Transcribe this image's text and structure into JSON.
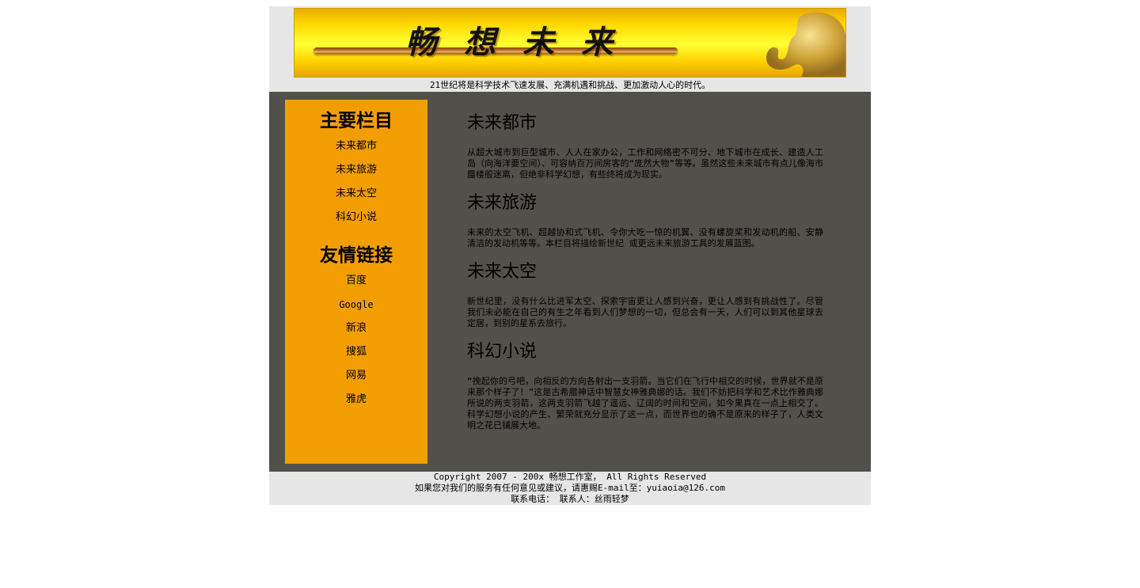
{
  "header": {
    "banner_title": "畅想未来",
    "tagline": "21世纪将是科学技术飞速发展、充满机遇和挑战、更加激动人心的时代。"
  },
  "sidebar": {
    "main_title": "主要栏目",
    "main_items": [
      "未来都市",
      "未来旅游",
      "未来太空",
      "科幻小说"
    ],
    "links_title": "友情链接",
    "link_items": [
      "百度",
      "Google",
      "新浪",
      "搜狐",
      "网易",
      "雅虎"
    ]
  },
  "content": {
    "sections": [
      {
        "title": "未来都市",
        "text": "从超大城市到巨型城市、人人在家办公，工作和网络密不可分、地下城市在成长、建造人工岛（向海洋要空间）、可容纳百万间房客的“庞然大物”等等。虽然这些未来城市有点儿像海市蜃楼般迷离，但绝非科学幻想，有些终将成为现实。"
      },
      {
        "title": "未来旅游",
        "text": "未来的太空飞机、超越协和式飞机、令你大吃一惊的机翼、没有螺旋桨和发动机的船、安静清洁的发动机等等。本栏目将描绘新世纪 或更远未来旅游工具的发展蓝图。"
      },
      {
        "title": "未来太空",
        "text": "新世纪里，没有什么比进军太空、探索宇宙更让人感到兴奋，更让人感到有挑战性了。尽管我们未必能在自己的有生之年看到人们梦想的一切，但总会有一天，人们可以到其他星球去定居，到别的星系去旅行。"
      },
      {
        "title": "科幻小说",
        "text": "“挽起你的弓吧，向相反的方向各射出一支羽箭。当它们在飞行中相交的时候，世界就不是原来那个样子了！”这是古希腊神话中智慧女神雅典娜的话。我们不妨把科学和艺术比作雅典娜所说的两支羽箭，这两支羽箭飞越了遥远、辽阔的时间和空间，如今果真在一点上相交了。科学幻想小说的产生、繁荣就充分显示了这一点，而世界也的确不是原来的样子了，人类文明之花已铺展大地。"
      }
    ]
  },
  "footer": {
    "copyright": "Copyright 2007 - 200x 畅想工作室， All Rights Reserved",
    "feedback": "如果您对我们的服务有任何意见或建议，请惠赐E-mail至：yuiaoia@126.com",
    "contact": "联系电话： 联系人：丝雨轻梦"
  },
  "colors": {
    "sidebar_bg": "#f29e03",
    "main_bg": "#52504b",
    "header_bg": "#e6e6e6"
  }
}
